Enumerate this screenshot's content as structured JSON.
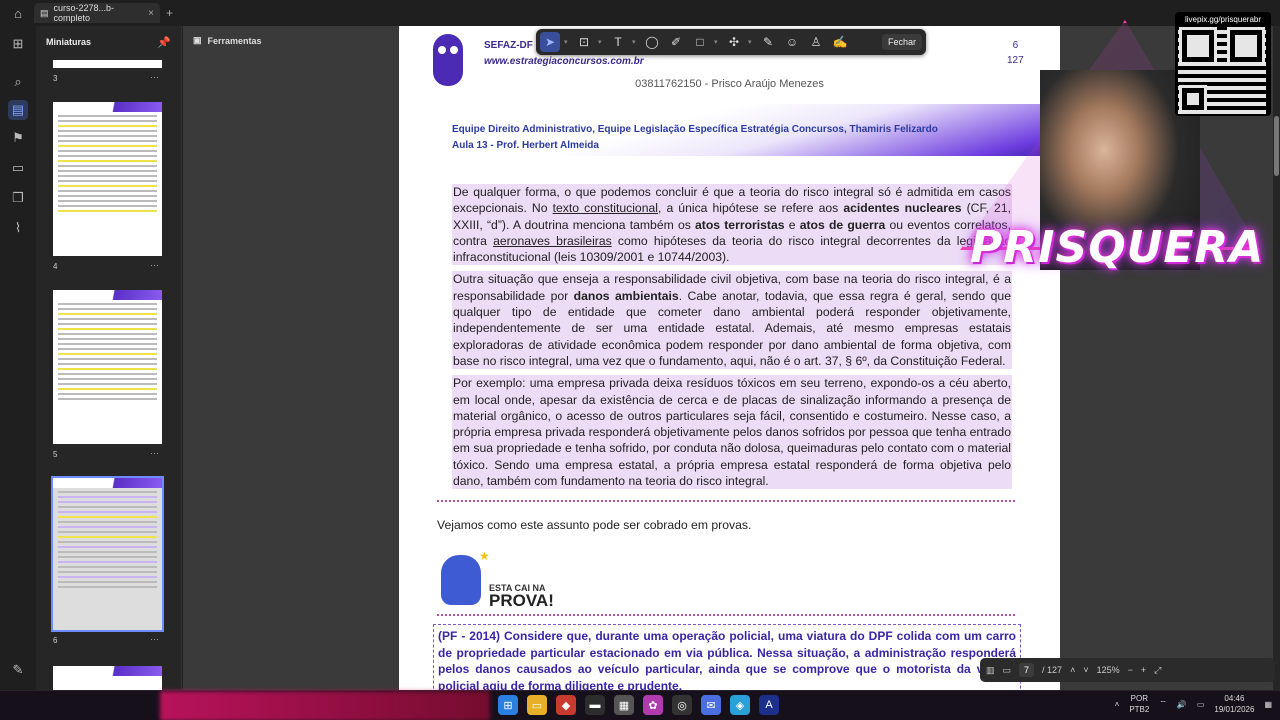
{
  "titlebar": {
    "tab_title": "curso-2278...b-completo",
    "close": "×",
    "new_tab": "+"
  },
  "thumbnails": {
    "header": "Miniaturas",
    "pages": [
      {
        "label": "3"
      },
      {
        "label": "4"
      },
      {
        "label": "5"
      },
      {
        "label": "6",
        "selected": true
      }
    ],
    "menu": "···"
  },
  "tools_label": "Ferramentas",
  "toolbar": {
    "close_label": "Fechar"
  },
  "page_header": {
    "org": "SEFAZ-DF",
    "site": "www.estrategiaconcursos.com.br",
    "page_num": "6",
    "page_total": "127",
    "owner": "03811762150 - Prisco Araújo Menezes",
    "team_line1": "Equipe Direito Administrativo, Equipe Legislação Específica Estratégia Concursos, Thamiris Felizardo",
    "team_line2": "Aula 13 - Prof. Herbert Almeida"
  },
  "content": {
    "p1_a": "De qualquer forma, o que podemos concluir é que a teoria do risco integral só é admitida em casos excepcionais. No ",
    "p1_u1": "texto constitucional",
    "p1_b": ", a única hipótese se refere aos ",
    "p1_bold1": "acidentes nucleares",
    "p1_c": " (CF, 21, XXIII, “d”). A doutrina menciona também os ",
    "p1_bold2": "atos terroristas",
    "p1_d": " e ",
    "p1_bold3": "atos de guerra",
    "p1_e": " ou eventos correlatos, contra ",
    "p1_u2": "aeronaves brasileiras",
    "p1_f": " como hipóteses da teoria do risco integral decorrentes da legislação infraconstitucional (leis 10309/2001 e 10744/2003).",
    "p2_a": "Outra situação que enseja a responsabilidade civil objetiva, com base na teoria do risco integral, é a responsabilidade por ",
    "p2_bold": "danos ambientais",
    "p2_b": ". Cabe anotar, todavia, que essa regra é geral, sendo que qualquer tipo de entidade que cometer dano ambiental poderá responder objetivamente, independentemente de ser uma entidade estatal. Ademais, até mesmo empresas estatais exploradoras de atividade econômica podem responder por dano ambiental de forma objetiva, com base no risco integral, uma vez que o fundamento, aqui, não é o art. 37, § 6º, da Constituição Federal.",
    "p3": "Por exemplo: uma empresa privada deixa resíduos tóxicos em seu terreno, expondo-os a céu aberto, em local onde, apesar da existência de cerca e de placas de sinalização informando a presença de material orgânico, o acesso de outros particulares seja fácil, consentido e costumeiro. Nesse caso, a própria empresa privada responderá objetivamente pelos danos sofridos por pessoa que tenha entrado em sua propriedade e tenha sofrido, por conduta não dolosa, queimaduras pelo contato com o material tóxico. Sendo uma empresa estatal, a própria empresa estatal responderá de forma objetiva pelo dano, também com fundamento na teoria do risco integral.",
    "vejamos": "Vejamos como este assunto pode ser cobrado em provas.",
    "esta_small": "ESTA CAI NA",
    "esta_big": "PROVA!",
    "question": "(PF - 2014) Considere que, durante uma operação policial, uma viatura do DPF colida com um carro de propriedade particular estacionado em via pública. Nessa situação, a administração responderá pelos danos causados ao veículo particular, ainda que se comprove que o motorista da viatura policial agiu de forma diligente e prudente."
  },
  "page_controls": {
    "current": "7",
    "total": "/ 127",
    "zoom": "125%"
  },
  "overlay": {
    "brand": "PRISQUERA",
    "qr_url": "livepix.gg/prisquerabr"
  },
  "tray": {
    "lang1": "POR",
    "lang2": "PTB2",
    "time": "04:46",
    "date": "19/01/2026"
  }
}
